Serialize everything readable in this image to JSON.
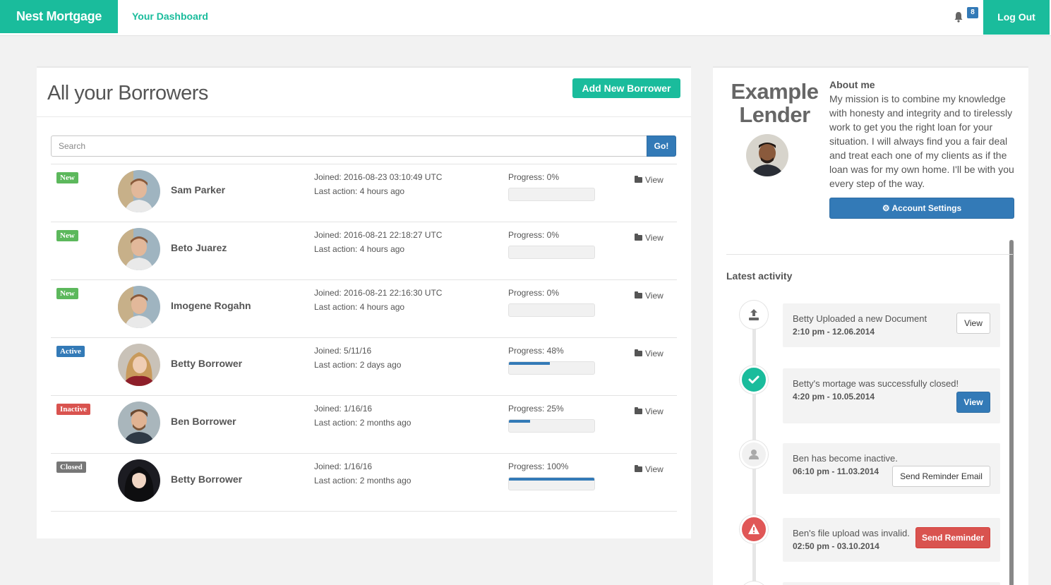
{
  "nav": {
    "brand": "Nest Mortgage",
    "dashboard_link": "Your Dashboard",
    "notification_count": "8",
    "logout": "Log Out"
  },
  "borrowers_panel": {
    "title": "All your Borrowers",
    "add_button": "Add New Borrower",
    "search_placeholder": "Search",
    "search_button": "Go!",
    "rows": [
      {
        "status": "New",
        "name": "Sam Parker",
        "joined": "Joined: 2016-08-23 03:10:49 UTC",
        "last_action": "Last action: 4 hours ago",
        "progress_label": "Progress: 0%",
        "progress": 0,
        "view": "View"
      },
      {
        "status": "New",
        "name": "Beto Juarez",
        "joined": "Joined: 2016-08-21 22:18:27 UTC",
        "last_action": "Last action: 4 hours ago",
        "progress_label": "Progress: 0%",
        "progress": 0,
        "view": "View"
      },
      {
        "status": "New",
        "name": "Imogene Rogahn",
        "joined": "Joined: 2016-08-21 22:16:30 UTC",
        "last_action": "Last action: 4 hours ago",
        "progress_label": "Progress: 0%",
        "progress": 0,
        "view": "View"
      },
      {
        "status": "Active",
        "name": "Betty Borrower",
        "joined": "Joined: 5/11/16",
        "last_action": "Last action: 2 days ago",
        "progress_label": "Progress: 48%",
        "progress": 48,
        "view": "View"
      },
      {
        "status": "Inactive",
        "name": "Ben Borrower",
        "joined": "Joined: 1/16/16",
        "last_action": "Last action: 2 months ago",
        "progress_label": "Progress: 25%",
        "progress": 25,
        "view": "View"
      },
      {
        "status": "Closed",
        "name": "Betty Borrower",
        "joined": "Joined: 1/16/16",
        "last_action": "Last action: 2 months ago",
        "progress_label": "Progress: 100%",
        "progress": 100,
        "view": "View"
      }
    ]
  },
  "lender": {
    "name": "Example Lender",
    "about_heading": "About me",
    "about_text": "My mission is to combine my knowledge with honesty and integrity and to tirelessly work to get you the right loan for your situation. I will always find you a fair deal and treat each one of my clients as if the loan was for my own home. I'll be with you every step of the way.",
    "account_button": "Account Settings",
    "activity_heading": "Latest activity",
    "activity": [
      {
        "icon": "upload-icon",
        "icon_bg": "#ffffff",
        "text": "Betty Uploaded a new Document",
        "time": "2:10 pm - 12.06.2014",
        "button": "View"
      },
      {
        "icon": "check-icon",
        "icon_bg": "#1abc9c",
        "text": "Betty's mortage was successfully closed!",
        "time": "4:20 pm - 10.05.2014",
        "button": "View"
      },
      {
        "icon": "user-icon",
        "icon_bg": "#f1f1f1",
        "text": "Ben has become inactive.",
        "time": "06:10 pm - 11.03.2014",
        "button": "Send Reminder Email"
      },
      {
        "icon": "warning-icon",
        "icon_bg": "#e05757",
        "text": "Ben's file upload was invalid.",
        "time": "02:50 pm - 03.10.2014",
        "button": "Send Reminder"
      }
    ]
  }
}
